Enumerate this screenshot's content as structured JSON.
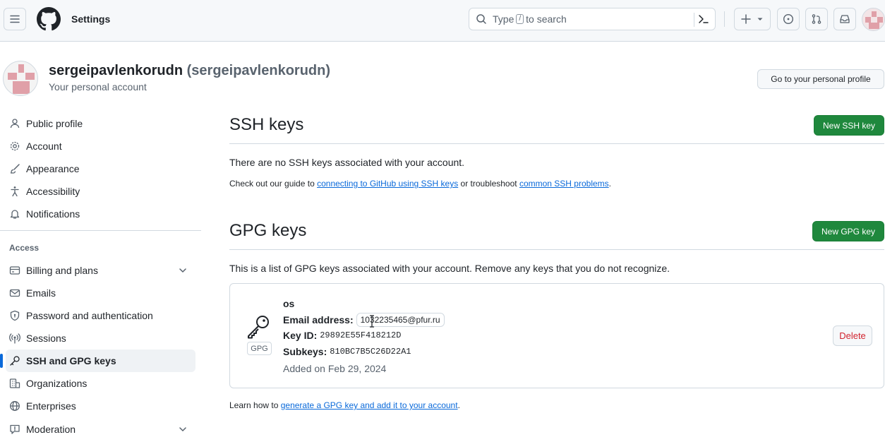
{
  "header": {
    "title": "Settings",
    "search_prefix": "Type",
    "search_slash": "/",
    "search_suffix": "to search"
  },
  "account": {
    "name": "sergeipavlenkorudn",
    "handle": "(sergeipavlenkorudn)",
    "subtitle": "Your personal account",
    "profile_button": "Go to your personal profile"
  },
  "sidebar": {
    "items": [
      {
        "label": "Public profile",
        "icon": "person-icon"
      },
      {
        "label": "Account",
        "icon": "gear-icon"
      },
      {
        "label": "Appearance",
        "icon": "paintbrush-icon"
      },
      {
        "label": "Accessibility",
        "icon": "accessibility-icon"
      },
      {
        "label": "Notifications",
        "icon": "bell-icon"
      }
    ],
    "access_heading": "Access",
    "access_items": [
      {
        "label": "Billing and plans",
        "icon": "credit-card-icon"
      },
      {
        "label": "Emails",
        "icon": "mail-icon"
      },
      {
        "label": "Password and authentication",
        "icon": "shield-lock-icon"
      },
      {
        "label": "Sessions",
        "icon": "broadcast-icon"
      },
      {
        "label": "SSH and GPG keys",
        "icon": "key-icon"
      },
      {
        "label": "Organizations",
        "icon": "organization-icon"
      },
      {
        "label": "Enterprises",
        "icon": "globe-icon"
      },
      {
        "label": "Moderation",
        "icon": "report-icon"
      }
    ]
  },
  "ssh": {
    "title": "SSH keys",
    "new_button": "New SSH key",
    "empty_text": "There are no SSH keys associated with your account.",
    "guide_prefix": "Check out our guide to",
    "guide_link": "connecting to GitHub using SSH keys",
    "guide_mid": "or troubleshoot",
    "guide_link2": "common SSH problems",
    "guide_end": "."
  },
  "gpg": {
    "title": "GPG keys",
    "new_button": "New GPG key",
    "description": "This is a list of GPG keys associated with your account. Remove any keys that you do not recognize.",
    "key": {
      "name": "os",
      "badge": "GPG",
      "email_label": "Email address:",
      "email": "1032235465@pfur.ru",
      "keyid_label": "Key ID:",
      "keyid": "29892E55F418212D",
      "subkeys_label": "Subkeys:",
      "subkeys": "810BC7B5C26D22A1",
      "added": "Added on Feb 29, 2024",
      "delete_button": "Delete"
    },
    "learn_prefix": "Learn how to",
    "learn_link": "generate a GPG key and add it to your account",
    "learn_end": "."
  },
  "colors": {
    "accent": "#0969da",
    "primary_button": "#1f883d",
    "danger": "#d1242f",
    "avatar_identicon": "#e0a0a8"
  }
}
